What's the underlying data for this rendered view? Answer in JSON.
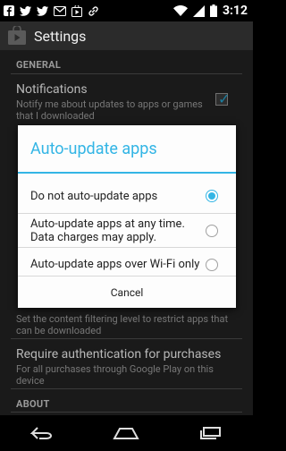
{
  "status_bar": {
    "time": "3:12",
    "left_icons": [
      "facebook-icon",
      "twitter-icon",
      "twitter-icon",
      "gmail-icon",
      "play-store-icon",
      "link-icon"
    ],
    "right_icons": [
      "wifi-icon",
      "signal-icon",
      "battery-icon"
    ]
  },
  "app_bar": {
    "title": "Settings",
    "icon": "play-store-icon"
  },
  "settings": {
    "general_header": "GENERAL",
    "notifications_title": "Notifications",
    "notifications_summary": "Notify me about updates to apps or games that I downloaded",
    "filter_summary": "Set the content filtering level to restrict apps that can be downloaded",
    "auth_title": "Require authentication for purchases",
    "auth_summary": "For all purchases through Google Play on this device",
    "about_header": "ABOUT"
  },
  "dialog": {
    "title": "Auto-update apps",
    "options": [
      {
        "label": "Do not auto-update apps",
        "selected": true
      },
      {
        "label": "Auto-update apps at any time. Data charges may apply.",
        "selected": false
      },
      {
        "label": "Auto-update apps over Wi-Fi only",
        "selected": false
      }
    ],
    "cancel_label": "Cancel"
  },
  "nav_bar": {
    "buttons": [
      "back-icon",
      "home-icon",
      "recents-icon"
    ]
  },
  "colors": {
    "accent": "#33b5e5"
  }
}
